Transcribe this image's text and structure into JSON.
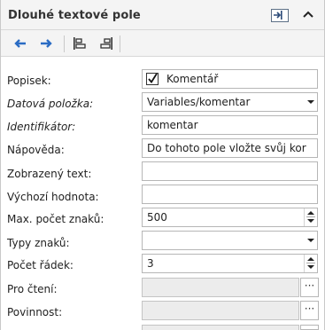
{
  "panel": {
    "title": "Dlouhé textové pole"
  },
  "icons": {
    "dock": "dock-panel-icon",
    "collapse": "chevron-up-icon",
    "prev": "arrow-left-icon",
    "next": "arrow-right-icon",
    "align_left": "align-left-icon",
    "align_right": "align-right-icon"
  },
  "colors": {
    "accent_blue": "#2b6cc4",
    "header_bg": "#f4f4f4"
  },
  "fields": {
    "popisek": {
      "label": "Popisek:",
      "value": "Komentář",
      "checked": true
    },
    "datova_polozka": {
      "label": "Datová položka:",
      "value": "Variables/komentar"
    },
    "identifikator": {
      "label": "Identifikátor:",
      "value": "komentar"
    },
    "napoveda": {
      "label": "Nápověda:",
      "value": "Do tohoto pole vložte svůj kor"
    },
    "zobrazeny_text": {
      "label": "Zobrazený text:",
      "value": ""
    },
    "vychozi_hodnota": {
      "label": "Výchozí hodnota:",
      "value": ""
    },
    "max_pocet_znaku": {
      "label": "Max. počet znaků:",
      "value": "500"
    },
    "typy_znaku": {
      "label": "Typy znaků:",
      "value": ""
    },
    "pocet_radek": {
      "label": "Počet řádek:",
      "value": "3"
    },
    "pro_cteni": {
      "label": "Pro čtení:",
      "value": "",
      "button": "···"
    },
    "povinnost": {
      "label": "Povinnost:",
      "value": "",
      "button": "···"
    }
  }
}
